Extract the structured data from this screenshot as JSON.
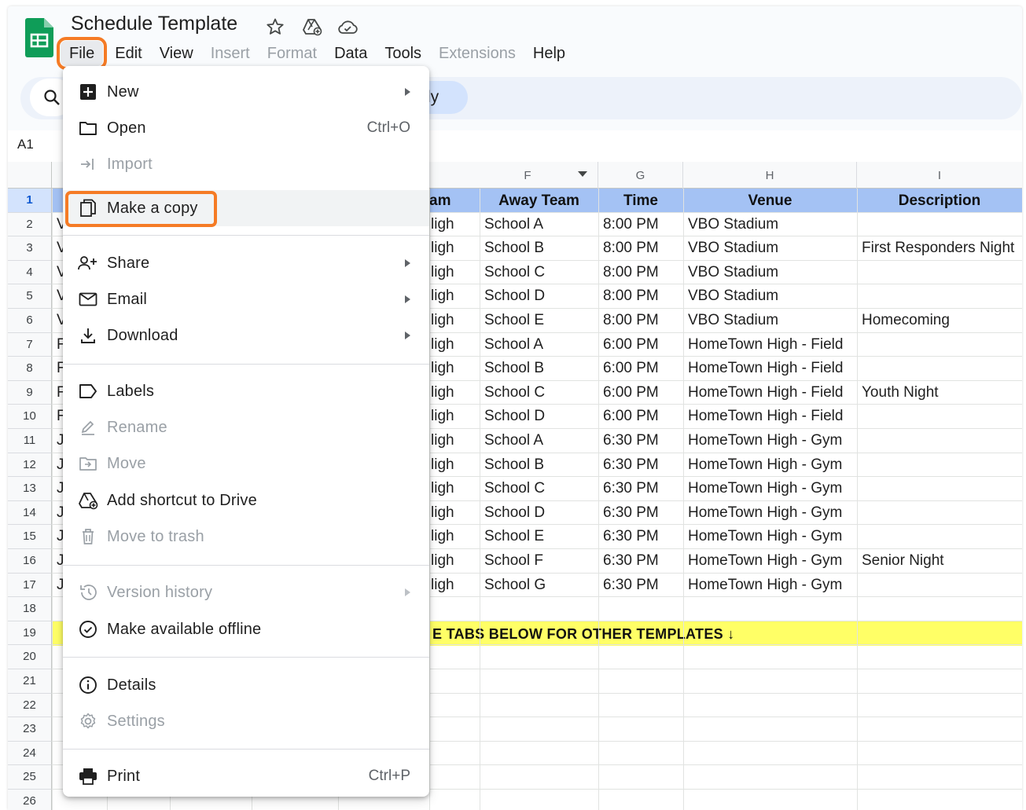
{
  "app": {
    "title": "Schedule Template",
    "menu": [
      {
        "label": "File",
        "disabled": false,
        "active": true
      },
      {
        "label": "Edit",
        "disabled": false
      },
      {
        "label": "View",
        "disabled": false
      },
      {
        "label": "Insert",
        "disabled": true
      },
      {
        "label": "Format",
        "disabled": true
      },
      {
        "label": "Data",
        "disabled": false
      },
      {
        "label": "Tools",
        "disabled": false
      },
      {
        "label": "Extensions",
        "disabled": true
      },
      {
        "label": "Help",
        "disabled": false
      }
    ],
    "toolbar_chip_text": "ly",
    "name_box": "A1"
  },
  "columns": {
    "F": "F",
    "G": "G",
    "H": "H",
    "I": "I"
  },
  "header_row": {
    "home_team_partial": "am",
    "away_team": "Away Team",
    "time": "Time",
    "venue": "Venue",
    "description": "Description"
  },
  "rows": [
    {
      "num": "2",
      "a": "V",
      "e": "ligh",
      "f": "School A",
      "g": "8:00 PM",
      "h": "VBO Stadium",
      "i": ""
    },
    {
      "num": "3",
      "a": "V",
      "e": "ligh",
      "f": "School B",
      "g": "8:00 PM",
      "h": "VBO Stadium",
      "i": "First Responders Night"
    },
    {
      "num": "4",
      "a": "V",
      "e": "ligh",
      "f": "School C",
      "g": "8:00 PM",
      "h": "VBO Stadium",
      "i": ""
    },
    {
      "num": "5",
      "a": "V",
      "e": "ligh",
      "f": "School D",
      "g": "8:00 PM",
      "h": "VBO Stadium",
      "i": ""
    },
    {
      "num": "6",
      "a": "V",
      "e": "ligh",
      "f": "School E",
      "g": "8:00 PM",
      "h": "VBO Stadium",
      "i": "Homecoming"
    },
    {
      "num": "7",
      "a": "F",
      "e": "ligh",
      "f": "School A",
      "g": "6:00 PM",
      "h": "HomeTown High - Field",
      "i": ""
    },
    {
      "num": "8",
      "a": "F",
      "e": "ligh",
      "f": "School B",
      "g": "6:00 PM",
      "h": "HomeTown High - Field",
      "i": ""
    },
    {
      "num": "9",
      "a": "F",
      "e": "ligh",
      "f": "School C",
      "g": "6:00 PM",
      "h": "HomeTown High - Field",
      "i": "Youth Night"
    },
    {
      "num": "10",
      "a": "F",
      "e": "ligh",
      "f": "School D",
      "g": "6:00 PM",
      "h": "HomeTown High - Field",
      "i": ""
    },
    {
      "num": "11",
      "a": "J",
      "e": "ligh",
      "f": "School A",
      "g": "6:30 PM",
      "h": "HomeTown High - Gym",
      "i": ""
    },
    {
      "num": "12",
      "a": "J",
      "e": "ligh",
      "f": "School B",
      "g": "6:30 PM",
      "h": "HomeTown High - Gym",
      "i": ""
    },
    {
      "num": "13",
      "a": "J",
      "e": "ligh",
      "f": "School C",
      "g": "6:30 PM",
      "h": "HomeTown High - Gym",
      "i": ""
    },
    {
      "num": "14",
      "a": "J",
      "e": "ligh",
      "f": "School D",
      "g": "6:30 PM",
      "h": "HomeTown High - Gym",
      "i": ""
    },
    {
      "num": "15",
      "a": "J",
      "e": "ligh",
      "f": "School E",
      "g": "6:30 PM",
      "h": "HomeTown High - Gym",
      "i": ""
    },
    {
      "num": "16",
      "a": "J",
      "e": "ligh",
      "f": "School F",
      "g": "6:30 PM",
      "h": "HomeTown High - Gym",
      "i": "Senior Night"
    },
    {
      "num": "17",
      "a": "J",
      "e": "ligh",
      "f": "School G",
      "g": "6:30 PM",
      "h": "HomeTown High - Gym",
      "i": ""
    }
  ],
  "row_numbers": [
    "1",
    "2",
    "3",
    "4",
    "5",
    "6",
    "7",
    "8",
    "9",
    "10",
    "11",
    "12",
    "13",
    "14",
    "15",
    "16",
    "17",
    "18",
    "19",
    "20",
    "21",
    "22",
    "23",
    "24",
    "25",
    "26"
  ],
  "banner_text": "E TABS BELOW FOR OTHER TEMPLATES ↓",
  "file_menu": {
    "new": "New",
    "open": "Open",
    "open_shortcut": "Ctrl+O",
    "import": "Import",
    "make_copy": "Make a copy",
    "share": "Share",
    "email": "Email",
    "download": "Download",
    "labels": "Labels",
    "rename": "Rename",
    "move": "Move",
    "add_shortcut": "Add shortcut to Drive",
    "move_trash": "Move to trash",
    "version_history": "Version history",
    "offline": "Make available offline",
    "details": "Details",
    "settings": "Settings",
    "print": "Print",
    "print_shortcut": "Ctrl+P"
  },
  "colors": {
    "highlight": "#f57b25",
    "header_band": "#a4c2f4",
    "banner": "#ffff66",
    "sheets_green": "#0f9d58"
  }
}
